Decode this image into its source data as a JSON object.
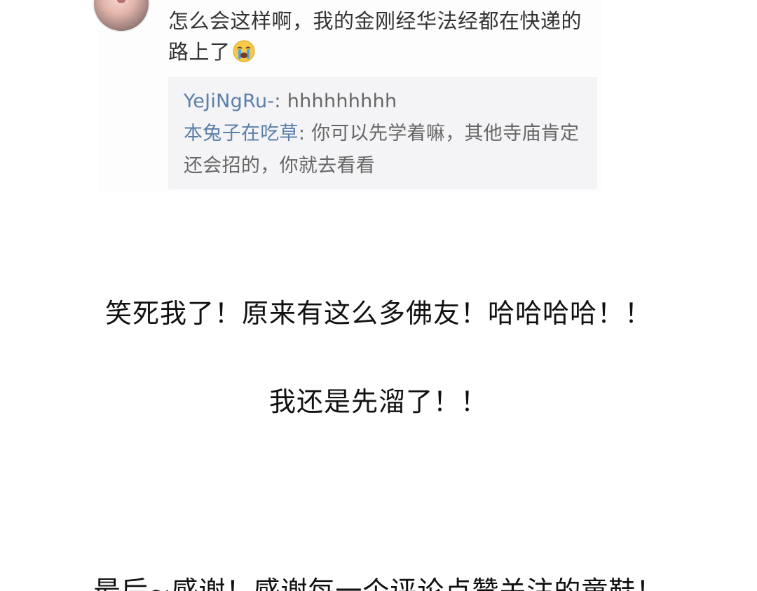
{
  "comment": {
    "text": "怎么会这样啊，我的金刚经华法经都在快递的路上了",
    "emoji": "crying-face-emoji"
  },
  "replies": [
    {
      "user": "YeJiNgRu-",
      "text": "hhhhhhhhh"
    },
    {
      "user": "本兔子在吃草",
      "text": "你可以先学着嘛，其他寺庙肯定还会招的，你就去看看"
    }
  ],
  "article": {
    "line1": "笑死我了！原来有这么多佛友！哈哈哈哈！！",
    "line2": "我还是先溜了！！",
    "line3": "最后~感谢！感谢每一个评论点赞关注的童鞋！"
  },
  "colors": {
    "username": "#5b7fa9",
    "reply_bg": "#f4f4f6",
    "text": "#333333"
  }
}
